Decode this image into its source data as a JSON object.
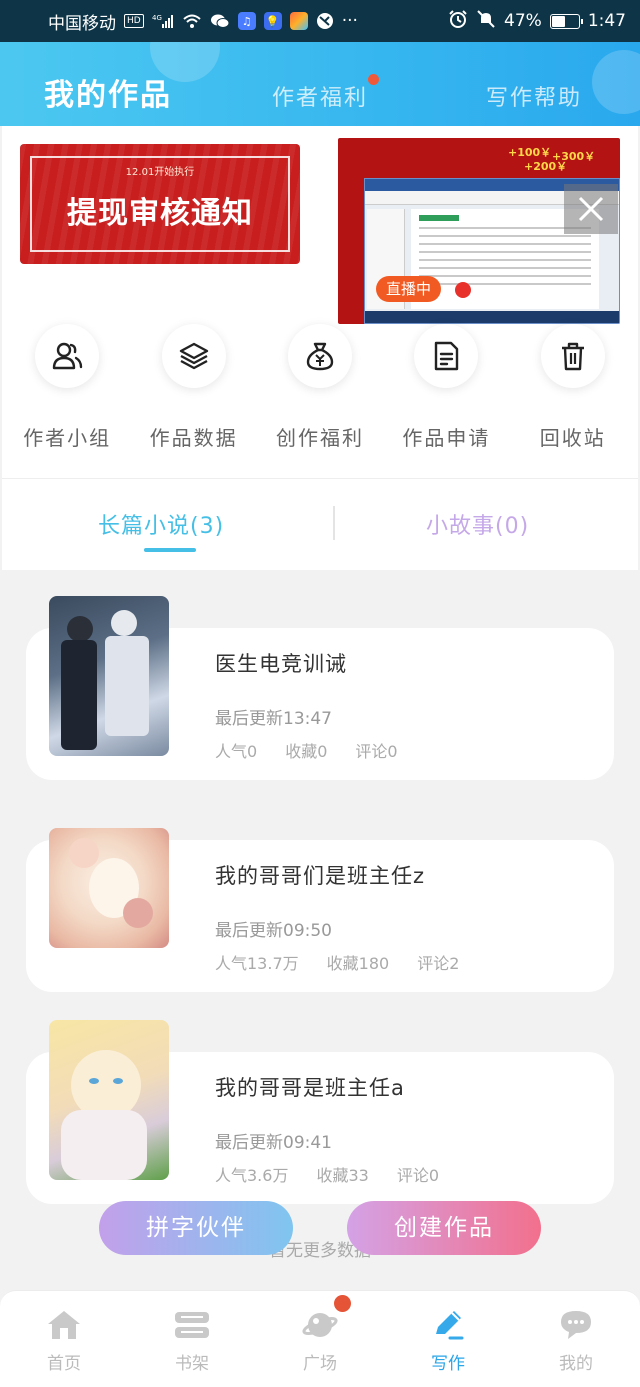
{
  "status_bar": {
    "carrier": "中国移动",
    "hd": "HD",
    "network": "4G",
    "battery_percent": "47%",
    "battery_level": 0.47,
    "time": "1:47"
  },
  "header": {
    "title": "我的作品",
    "tabs": [
      "作者福利",
      "写作帮助"
    ]
  },
  "banner": {
    "small_text": "12.01开始执行",
    "title": "提现审核通知"
  },
  "live_overlay": {
    "promo_texts": [
      "+100￥",
      "+300￥",
      "+200￥"
    ],
    "badge": "直播中"
  },
  "quick_actions": [
    {
      "label": "作者小组",
      "icon": "group-icon"
    },
    {
      "label": "作品数据",
      "icon": "layers-icon"
    },
    {
      "label": "创作福利",
      "icon": "money-bag-icon"
    },
    {
      "label": "作品申请",
      "icon": "document-icon"
    },
    {
      "label": "回收站",
      "icon": "trash-icon"
    }
  ],
  "sub_tabs": {
    "novel": "长篇小说(3)",
    "story": "小故事(0)"
  },
  "works": [
    {
      "title": "医生电竞训诫",
      "updated": "最后更新13:47",
      "popularity": "人气0",
      "favorites": "收藏0",
      "comments": "评论0"
    },
    {
      "title": "我的哥哥们是班主任z",
      "updated": "最后更新09:50",
      "popularity": "人气13.7万",
      "favorites": "收藏180",
      "comments": "评论2"
    },
    {
      "title": "我的哥哥是班主任a",
      "updated": "最后更新09:41",
      "popularity": "人气3.6万",
      "favorites": "收藏33",
      "comments": "评论0"
    }
  ],
  "floating_buttons": {
    "partner": "拼字伙伴",
    "create": "创建作品"
  },
  "footer_text": "暂无更多数据",
  "bottom_nav": [
    {
      "label": "首页",
      "icon": "home-icon"
    },
    {
      "label": "书架",
      "icon": "bookshelf-icon"
    },
    {
      "label": "广场",
      "icon": "planet-icon"
    },
    {
      "label": "写作",
      "icon": "pen-icon"
    },
    {
      "label": "我的",
      "icon": "chat-icon"
    }
  ],
  "colors": {
    "accent": "#45bfe6",
    "header_gradient_start": "#4cc8f0",
    "header_gradient_end": "#2aa8ee",
    "badge_red": "#e55436"
  }
}
